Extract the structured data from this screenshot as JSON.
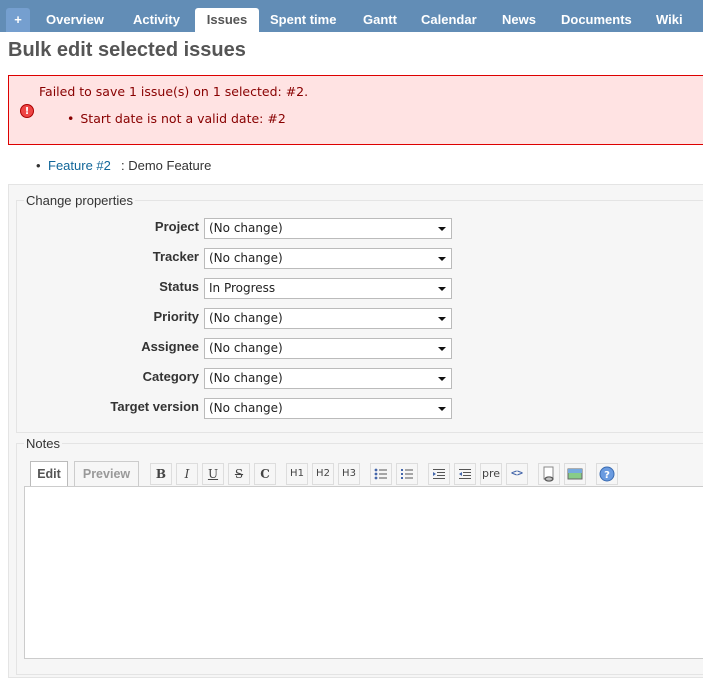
{
  "nav": {
    "tabs": [
      {
        "label": "+"
      },
      {
        "label": "Overview"
      },
      {
        "label": "Activity"
      },
      {
        "label": "Issues",
        "selected": true
      },
      {
        "label": "Spent time"
      },
      {
        "label": "Gantt"
      },
      {
        "label": "Calendar"
      },
      {
        "label": "News"
      },
      {
        "label": "Documents"
      },
      {
        "label": "Wiki"
      }
    ]
  },
  "page": {
    "title": "Bulk edit selected issues"
  },
  "error": {
    "title": "Failed to save 1 issue(s) on 1 selected: #2.",
    "items": [
      "Start date is not a valid date: #2"
    ]
  },
  "issue": {
    "link": "Feature #2",
    "rest": ": Demo Feature"
  },
  "properties": {
    "legend": "Change properties",
    "fields": [
      {
        "label": "Project",
        "value": "(No change)"
      },
      {
        "label": "Tracker",
        "value": "(No change)"
      },
      {
        "label": "Status",
        "value": "In Progress"
      },
      {
        "label": "Priority",
        "value": "(No change)"
      },
      {
        "label": "Assignee",
        "value": "(No change)"
      },
      {
        "label": "Category",
        "value": "(No change)"
      },
      {
        "label": "Target version",
        "value": "(No change)"
      }
    ]
  },
  "notes": {
    "legend": "Notes",
    "tab_edit": "Edit",
    "tab_preview": "Preview",
    "toolbar": {
      "bold": "B",
      "italic": "I",
      "underline": "U",
      "strike": "S",
      "code": "C",
      "h1": "H1",
      "h2": "H2",
      "h3": "H3",
      "pre": "pre"
    }
  },
  "colors": {
    "header": "#628db6",
    "error_bg": "#ffe3e3",
    "link": "#169"
  }
}
